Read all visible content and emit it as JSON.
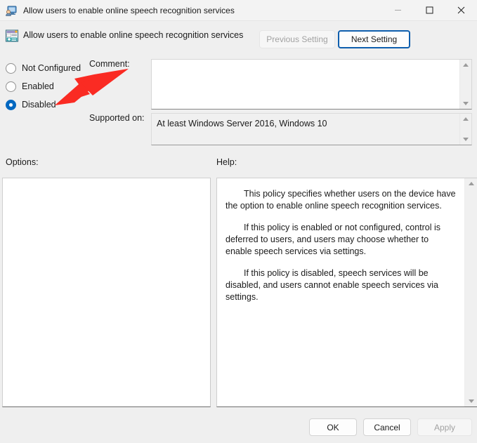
{
  "window": {
    "title": "Allow users to enable online speech recognition services",
    "icon": "policy-monitor-icon",
    "controls": {
      "minimize": "—",
      "maximize": "☐",
      "close": "✕"
    }
  },
  "header": {
    "icon": "policy-setting-icon",
    "policy_title": "Allow users to enable online speech recognition services",
    "previous_setting_label": "Previous Setting",
    "next_setting_label": "Next Setting"
  },
  "state_options": {
    "items": [
      {
        "label": "Not Configured",
        "checked": false
      },
      {
        "label": "Enabled",
        "checked": false
      },
      {
        "label": "Disabled",
        "checked": true
      }
    ]
  },
  "comment": {
    "label": "Comment:",
    "value": "",
    "placeholder": ""
  },
  "supported_on": {
    "label": "Supported on:",
    "value": "At least Windows Server 2016, Windows 10"
  },
  "options": {
    "label": "Options:",
    "content": ""
  },
  "help": {
    "label": "Help:",
    "paragraphs": [
      "This policy specifies whether users on the device have the option to enable online speech recognition services.",
      "If this policy is enabled or not configured, control is deferred to users, and users may choose whether to enable speech services via settings.",
      "If this policy is disabled, speech services will be disabled, and users cannot enable speech services via settings."
    ]
  },
  "footer": {
    "ok_label": "OK",
    "cancel_label": "Cancel",
    "apply_label": "Apply"
  },
  "annotation": {
    "type": "red-arrow",
    "points_to": "Disabled",
    "color": "#fa2b23"
  },
  "colors": {
    "accent": "#0067c0",
    "window_background": "#efefef",
    "titlebar_background": "#f3f3f3",
    "annotation_red": "#fa2b23",
    "focus_border": "#0f5fae"
  }
}
